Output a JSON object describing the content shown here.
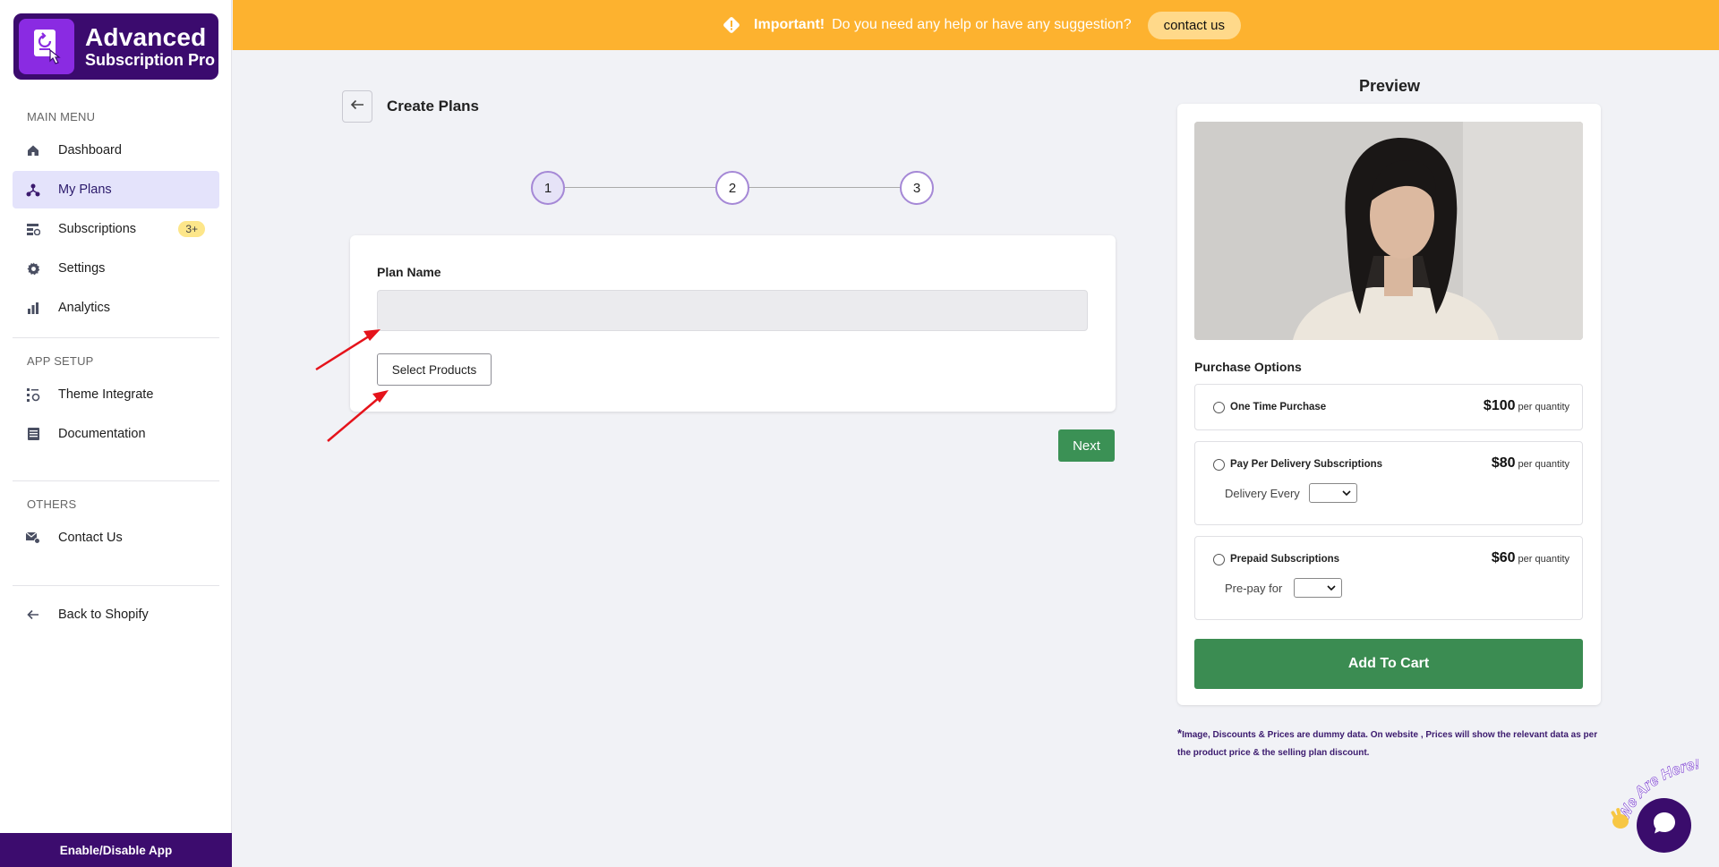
{
  "app": {
    "logo_line1": "Advanced",
    "logo_line2": "Subscription Pro"
  },
  "sidebar": {
    "main_menu_label": "MAIN MENU",
    "main_items": [
      {
        "label": "Dashboard",
        "icon": "home-icon"
      },
      {
        "label": "My Plans",
        "icon": "plans-icon",
        "active": true
      },
      {
        "label": "Subscriptions",
        "icon": "subscriptions-icon",
        "badge": "3+"
      },
      {
        "label": "Settings",
        "icon": "gear-icon"
      },
      {
        "label": "Analytics",
        "icon": "bar-chart-icon"
      }
    ],
    "app_setup_label": "APP SETUP",
    "app_setup_items": [
      {
        "label": "Theme Integrate",
        "icon": "theme-icon"
      },
      {
        "label": "Documentation",
        "icon": "document-icon"
      }
    ],
    "others_label": "OTHERS",
    "others_items": [
      {
        "label": "Contact Us",
        "icon": "mail-icon"
      }
    ],
    "back_label": "Back to Shopify",
    "enable_label": "Enable/Disable App"
  },
  "banner": {
    "important": "Important!",
    "message": "Do you need any help or have any suggestion?",
    "contact": "contact us"
  },
  "page": {
    "title": "Create Plans",
    "steps": [
      "1",
      "2",
      "3"
    ],
    "current_step": 1,
    "plan_name_label": "Plan Name",
    "plan_name_value": "",
    "select_products": "Select Products",
    "next": "Next"
  },
  "preview": {
    "title": "Preview",
    "purchase_options_label": "Purchase Options",
    "options": [
      {
        "name": "One Time Purchase",
        "price": "$100",
        "per": "per quantity"
      },
      {
        "name": "Pay Per Delivery Subscriptions",
        "price": "$80",
        "per": "per quantity",
        "sub_label": "Delivery Every"
      },
      {
        "name": "Prepaid Subscriptions",
        "price": "$60",
        "per": "per quantity",
        "sub_label": "Pre-pay for"
      }
    ],
    "add_to_cart": "Add To Cart",
    "disclaimer_star": "*",
    "disclaimer": "Image, Discounts & Prices are dummy data. On website , Prices will show the relevant data as per the product price & the selling plan discount."
  },
  "chat": {
    "tagline": "We Are Here!"
  },
  "colors": {
    "brand_purple": "#3b0b6e",
    "banner": "#fdb22f",
    "green": "#3b9155",
    "active_nav": "#e4e3fb"
  }
}
